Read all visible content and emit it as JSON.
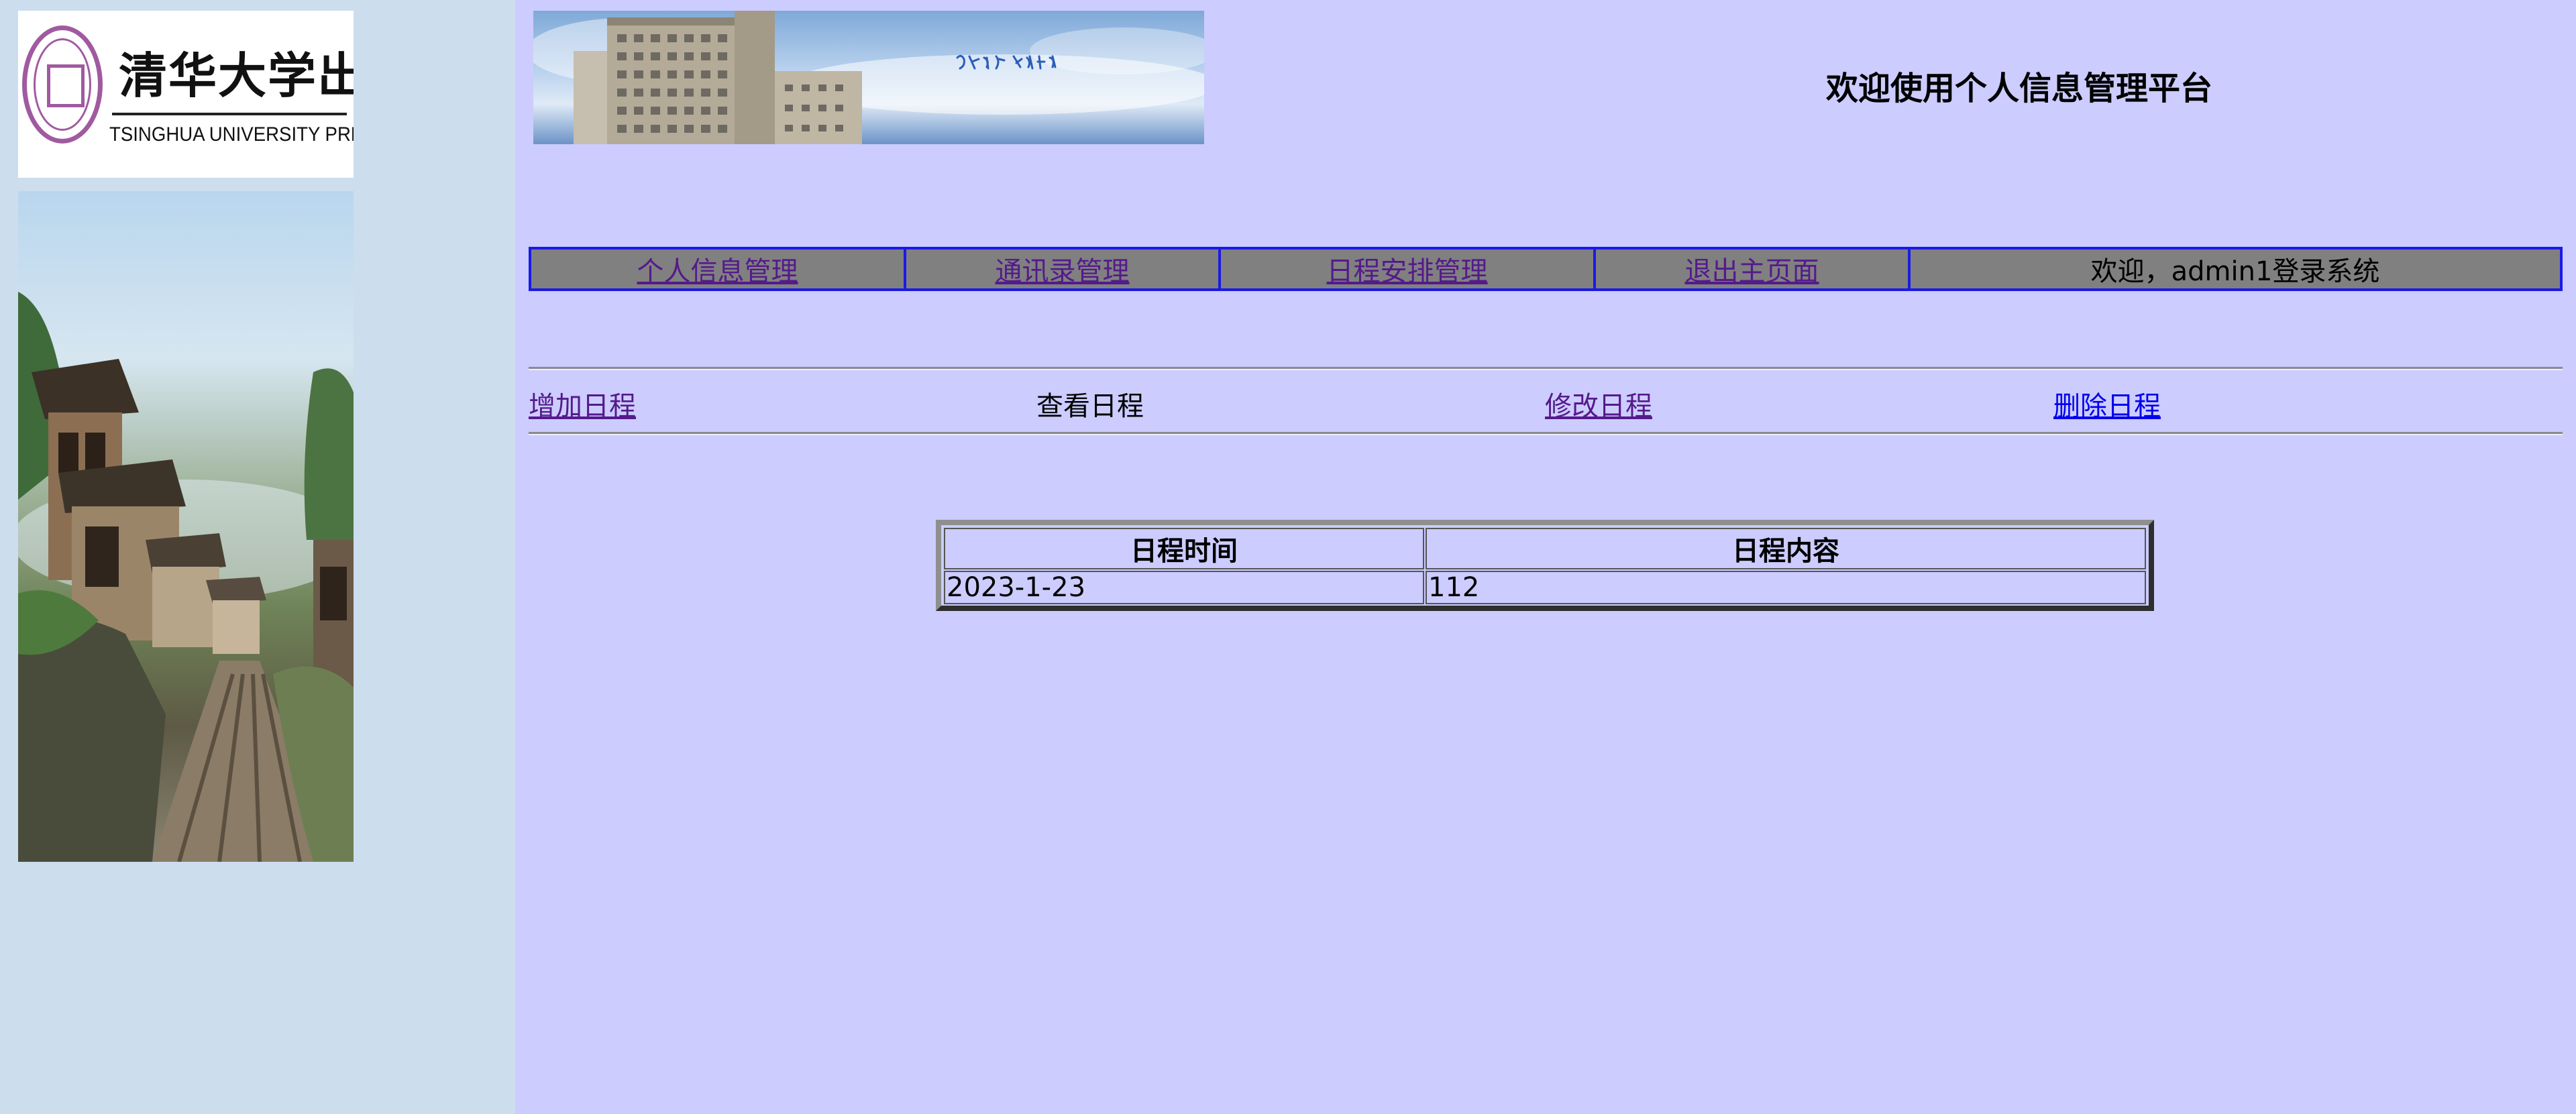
{
  "left_frame": {
    "logo": {
      "name_cn": "清华大学出版社",
      "name_en": "TSINGHUA UNIVERSITY PRESS"
    }
  },
  "header": {
    "title": "欢迎使用个人信息管理平台"
  },
  "nav": {
    "items": [
      {
        "label": "个人信息管理"
      },
      {
        "label": "通讯录管理"
      },
      {
        "label": "日程安排管理"
      },
      {
        "label": "退出主页面"
      }
    ],
    "greeting": "欢迎，admin1登录系统"
  },
  "submenu": {
    "add": "增加日程",
    "view": "查看日程",
    "edit": "修改日程",
    "delete": "删除日程"
  },
  "schedule_table": {
    "headers": [
      "日程时间",
      "日程内容"
    ],
    "rows": [
      [
        "2023-1-23",
        "112"
      ]
    ]
  },
  "colors": {
    "page_bg": "#ccccff",
    "left_frame_bg": "#ccddee",
    "nav_bg": "#808080",
    "nav_border": "#1a1ae6",
    "visited_link": "#551a8b",
    "link": "#0000ee"
  }
}
